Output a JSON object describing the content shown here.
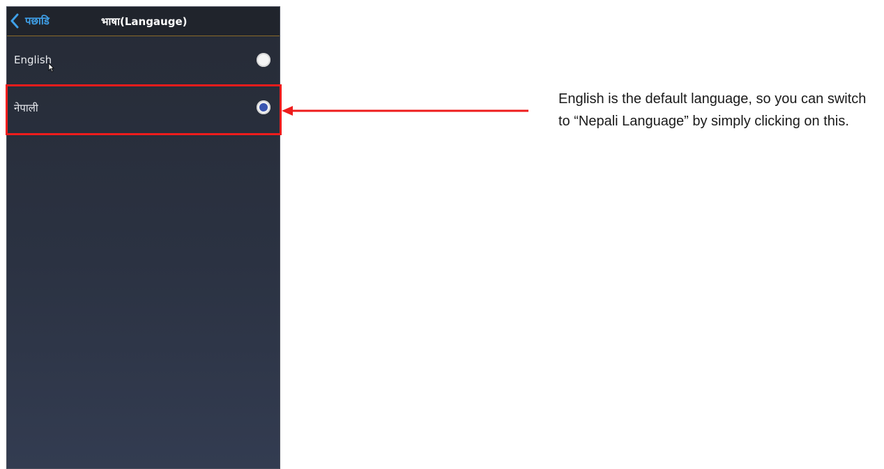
{
  "appbar": {
    "back_label": "पछाडि",
    "title": "भाषा(Langauge)"
  },
  "languages": [
    {
      "label": "English",
      "selected": false
    },
    {
      "label": "नेपाली",
      "selected": true
    }
  ],
  "annotation": {
    "text": "English is the default language, so you can switch to “Nepali Language” by simply clicking on this."
  },
  "colors": {
    "accent": "#3fa0e8",
    "highlight": "#ee1c1c",
    "radio_selected": "#3a55b0"
  },
  "icons": {
    "back": "chevron-left-icon",
    "cursor": "mouse-pointer-icon",
    "arrow": "arrow-left-icon"
  }
}
